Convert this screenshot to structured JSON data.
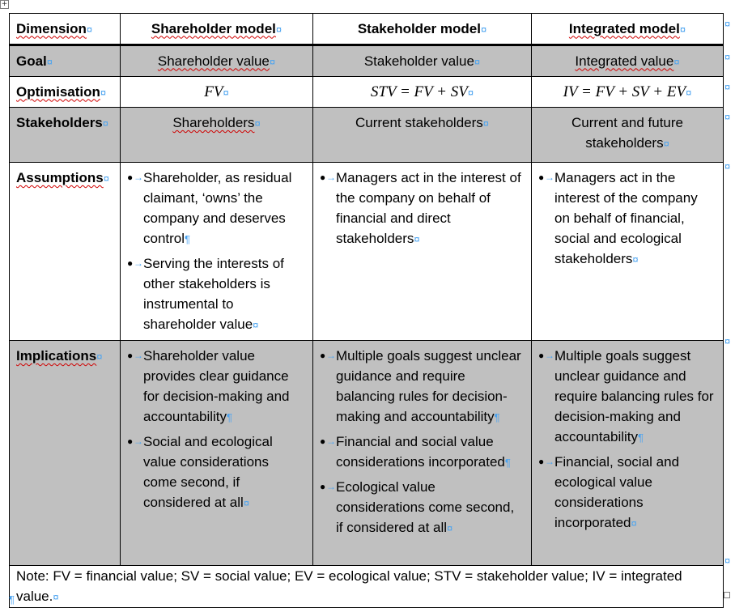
{
  "header": {
    "dimension": "Dimension",
    "shareholder_model": "Shareholder model",
    "stakeholder_model": "Stakeholder model",
    "integrated_model": "Integrated model"
  },
  "rows": {
    "goal": {
      "label": "Goal",
      "shareholder": "Shareholder value",
      "stakeholder": "Stakeholder value",
      "integrated": "Integrated value"
    },
    "optimisation": {
      "label": "Optimisation",
      "shareholder": "FV",
      "stakeholder": "STV = FV + SV",
      "integrated": "IV = FV + SV + EV"
    },
    "stakeholders": {
      "label": "Stakeholders",
      "shareholder": "Shareholders",
      "stakeholder": "Current stakeholders",
      "integrated": "Current and future stakeholders"
    },
    "assumptions": {
      "label": "Assumptions",
      "shareholder": [
        "Shareholder, as residual claimant, ‘owns’ the company and deserves control",
        "Serving the interests of other stakeholders is instrumental to shareholder value"
      ],
      "stakeholder": [
        "Managers act in the interest of the company on behalf of financial and direct stakeholders"
      ],
      "integrated": [
        "Managers act in the interest of the company on behalf of financial, social and ecological stakeholders"
      ]
    },
    "implications": {
      "label": "Implications",
      "shareholder": [
        "Shareholder value provides clear guidance for decision-making and accountability",
        "Social and ecological value considerations come second, if considered at all"
      ],
      "stakeholder": [
        "Multiple goals suggest unclear guidance and require balancing rules for decision-making and accountability",
        "Financial and social value considerations incorporated",
        "Ecological value considerations come second, if considered at all"
      ],
      "integrated": [
        "Multiple goals suggest unclear guidance and require balancing rules for decision-making and accountability",
        "Financial, social and ecological value considerations incorporated"
      ]
    }
  },
  "note": "Note: FV = financial value; SV = social value; EV = ecological value; STV = stakeholder value; IV = integrated value.",
  "marks": {
    "cell_end": "¤",
    "paragraph": "¶",
    "bullet": "●",
    "tab_arrow": "→",
    "move_handle": "⇕"
  }
}
